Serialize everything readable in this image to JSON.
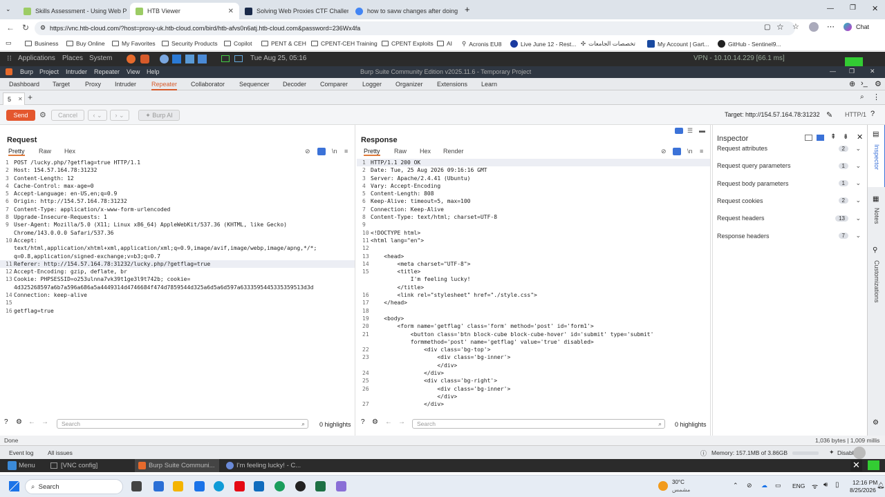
{
  "browser": {
    "tabs": [
      {
        "label": "Skills Assessment - Using Web Pro",
        "color": "#9ccc65"
      },
      {
        "label": "HTB Viewer",
        "color": "#9ccc65"
      },
      {
        "label": "Solving Web Proxies CTF Challeng",
        "color": "#1a2a4a"
      },
      {
        "label": "how to savw changes after doing",
        "color": "#4285f4"
      }
    ],
    "url": "https://vnc.htb-cloud.com/?host=proxy-uk.htb-cloud.com/bird/htb-afvs0n6atj.htb-cloud.com&password=236Wx4fa",
    "profile_label": "Chat",
    "bookmarks": [
      "Business",
      "Buy Online",
      "My Favorites",
      "Security Products",
      "Copilot",
      "PENT & CEH",
      "CPENT-CEH Training",
      "CPENT Exploits",
      "AI",
      "Acronis EU8",
      "Live June 12 - Rest...",
      "تخصصات الجامعات",
      "My Account | Gart...",
      "GitHub - Sentinel9..."
    ]
  },
  "gnome": {
    "menus": [
      "Applications",
      "Places",
      "System"
    ],
    "datetime": "Tue Aug 25, 05:16",
    "vpn": "VPN - 10.10.14.229 [66.1 ms]"
  },
  "burp": {
    "menu": [
      "Burp",
      "Project",
      "Intruder",
      "Repeater",
      "View",
      "Help"
    ],
    "title": "Burp Suite Community Edition v2025.11.6 - Temporary Project",
    "tools": [
      "Dashboard",
      "Target",
      "Proxy",
      "Intruder",
      "Repeater",
      "Collaborator",
      "Sequencer",
      "Decoder",
      "Comparer",
      "Logger",
      "Organizer",
      "Extensions",
      "Learn"
    ],
    "active_tool": "Repeater",
    "repeater_tab": "5",
    "send_label": "Send",
    "cancel_label": "Cancel",
    "burp_ai_label": "Burp AI",
    "target_label": "Target: http://154.57.164.78:31232",
    "http_version": "HTTP/1",
    "request": {
      "title": "Request",
      "tabs": [
        "Pretty",
        "Raw",
        "Hex"
      ],
      "lines": [
        {
          "n": "1",
          "t": "POST /lucky.php/?getflag=true HTTP/1.1"
        },
        {
          "n": "2",
          "t": "Host: 154.57.164.78:31232"
        },
        {
          "n": "3",
          "t": "Content-Length: 12"
        },
        {
          "n": "4",
          "t": "Cache-Control: max-age=0"
        },
        {
          "n": "5",
          "t": "Accept-Language: en-US,en;q=0.9"
        },
        {
          "n": "6",
          "t": "Origin: http://154.57.164.78:31232"
        },
        {
          "n": "7",
          "t": "Content-Type: application/x-www-form-urlencoded"
        },
        {
          "n": "8",
          "t": "Upgrade-Insecure-Requests: 1"
        },
        {
          "n": "9",
          "t": "User-Agent: Mozilla/5.0 (X11; Linux x86_64) AppleWebKit/537.36 (KHTML, like Gecko)"
        },
        {
          "n": "",
          "t": "Chrome/143.0.0.0 Safari/537.36"
        },
        {
          "n": "10",
          "t": "Accept:"
        },
        {
          "n": "",
          "t": "text/html,application/xhtml+xml,application/xml;q=0.9,image/avif,image/webp,image/apng,*/*;"
        },
        {
          "n": "",
          "t": "q=0.8,application/signed-exchange;v=b3;q=0.7"
        },
        {
          "n": "11",
          "t": "Referer: http://154.57.164.78:31232/lucky.php/?getflag=true"
        },
        {
          "n": "12",
          "t": "Accept-Encoding: gzip, deflate, br"
        },
        {
          "n": "13",
          "t": "Cookie: PHPSESSID=o253ulnna7vk39t1ge3l9t742b; cookie="
        },
        {
          "n": "",
          "t": "4d325268597a6b7a596a686a5a4449314d4746684f474d7859544d325a6d5a6d597a6333595445335359513d3d"
        },
        {
          "n": "14",
          "t": "Connection: keep-alive"
        },
        {
          "n": "15",
          "t": ""
        },
        {
          "n": "16",
          "t": "getflag=true"
        }
      ],
      "search_placeholder": "Search",
      "highlights": "0 highlights"
    },
    "response": {
      "title": "Response",
      "tabs": [
        "Pretty",
        "Raw",
        "Hex",
        "Render"
      ],
      "lines": [
        {
          "n": "1",
          "t": "HTTP/1.1 200 OK"
        },
        {
          "n": "2",
          "t": "Date: Tue, 25 Aug 2026 09:16:16 GMT"
        },
        {
          "n": "3",
          "t": "Server: Apache/2.4.41 (Ubuntu)"
        },
        {
          "n": "4",
          "t": "Vary: Accept-Encoding"
        },
        {
          "n": "5",
          "t": "Content-Length: 808"
        },
        {
          "n": "6",
          "t": "Keep-Alive: timeout=5, max=100"
        },
        {
          "n": "7",
          "t": "Connection: Keep-Alive"
        },
        {
          "n": "8",
          "t": "Content-Type: text/html; charset=UTF-8"
        },
        {
          "n": "9",
          "t": ""
        },
        {
          "n": "10",
          "t": "<!DOCTYPE html>"
        },
        {
          "n": "11",
          "t": "<html lang=\"en\">"
        },
        {
          "n": "12",
          "t": ""
        },
        {
          "n": "13",
          "t": "    <head>"
        },
        {
          "n": "14",
          "t": "        <meta charset=\"UTF-8\">"
        },
        {
          "n": "15",
          "t": "        <title>"
        },
        {
          "n": "",
          "t": "            I'm feeling lucky!"
        },
        {
          "n": "",
          "t": "        </title>"
        },
        {
          "n": "16",
          "t": "        <link rel=\"stylesheet\" href=\"./style.css\">"
        },
        {
          "n": "17",
          "t": "    </head>"
        },
        {
          "n": "18",
          "t": ""
        },
        {
          "n": "19",
          "t": "    <body>"
        },
        {
          "n": "20",
          "t": "        <form name='getflag' class='form' method='post' id='form1'>"
        },
        {
          "n": "21",
          "t": "            <button class='btn block-cube block-cube-hover' id='submit' type='submit'"
        },
        {
          "n": "",
          "t": "            formmethod='post' name='getflag' value='true' disabled>"
        },
        {
          "n": "22",
          "t": "                <div class='bg-top'>"
        },
        {
          "n": "23",
          "t": "                    <div class='bg-inner'>"
        },
        {
          "n": "",
          "t": "                    </div>"
        },
        {
          "n": "24",
          "t": "                </div>"
        },
        {
          "n": "25",
          "t": "                <div class='bg-right'>"
        },
        {
          "n": "26",
          "t": "                    <div class='bg-inner'>"
        },
        {
          "n": "",
          "t": "                    </div>"
        },
        {
          "n": "27",
          "t": "                </div>"
        }
      ],
      "search_placeholder": "Search",
      "highlights": "0 highlights"
    },
    "inspector": {
      "title": "Inspector",
      "rows": [
        {
          "label": "Request attributes",
          "count": "2"
        },
        {
          "label": "Request query parameters",
          "count": "1"
        },
        {
          "label": "Request body parameters",
          "count": "1"
        },
        {
          "label": "Request cookies",
          "count": "2"
        },
        {
          "label": "Request headers",
          "count": "13"
        },
        {
          "label": "Response headers",
          "count": "7"
        }
      ]
    },
    "sidebar": [
      "Inspector",
      "Notes",
      "Customizations"
    ],
    "status_left": "Done",
    "status_right": "1,036 bytes | 1,009 millis",
    "event_log": "Event log",
    "all_issues": "All issues",
    "memory": "Memory: 157.1MB of 3.86GB",
    "disabled": "Disabled"
  },
  "gnome_taskbar": {
    "menu": "Menu",
    "items": [
      "[VNC config]",
      "Burp Suite Communi...",
      "I'm feeling lucky! - C..."
    ]
  },
  "windows": {
    "search": "Search",
    "weather_temp": "30°C",
    "weather_desc": "مشمس",
    "lang": "ENG",
    "time": "12:16 PM",
    "date": "8/25/2026"
  }
}
